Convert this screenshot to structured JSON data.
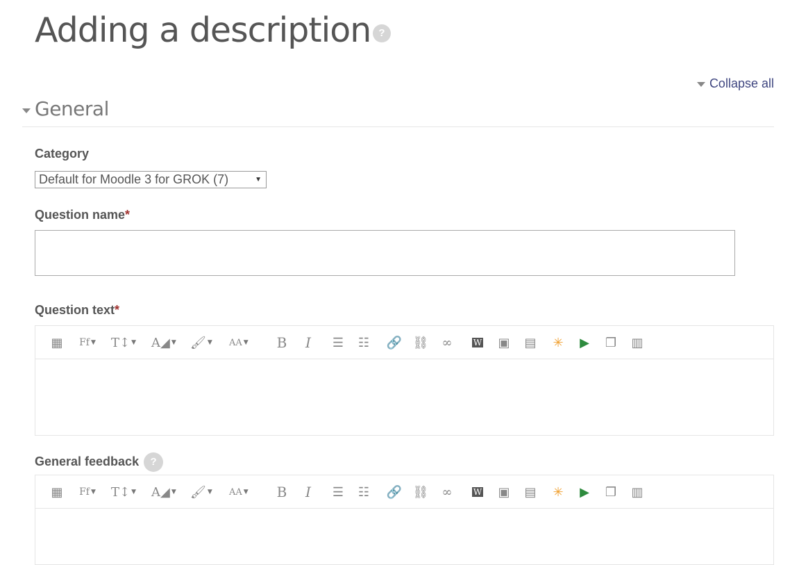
{
  "page": {
    "title": "Adding a description",
    "help_glyph": "?",
    "collapse_all": "Collapse all"
  },
  "section": {
    "title": "General"
  },
  "fields": {
    "category_label": "Category",
    "category_value": "Default for Moodle 3 for GROK (7)",
    "question_name_label": "Question name",
    "question_text_label": "Question text",
    "general_feedback_label": "General feedback",
    "required_mark": "*",
    "question_name_value": ""
  },
  "toolbar": {
    "buttons": [
      {
        "name": "show-more-buttons-icon",
        "glyph": "▦"
      },
      {
        "name": "font-family-icon",
        "glyph": "Ff"
      },
      {
        "name": "font-size-icon",
        "glyph": "T↕"
      },
      {
        "name": "font-color-icon",
        "glyph": "A◢"
      },
      {
        "name": "background-color-icon",
        "glyph": "🖌"
      },
      {
        "name": "text-style-icon",
        "glyph": "AA"
      },
      {
        "name": "bold-icon",
        "glyph": "B"
      },
      {
        "name": "italic-icon",
        "glyph": "I"
      },
      {
        "name": "unordered-list-icon",
        "glyph": "☰"
      },
      {
        "name": "ordered-list-icon",
        "glyph": "☷"
      },
      {
        "name": "link-icon",
        "glyph": "🔗"
      },
      {
        "name": "unlink-icon",
        "glyph": "⛓"
      },
      {
        "name": "auto-link-icon",
        "glyph": "∞"
      },
      {
        "name": "word-icon",
        "glyph": "W"
      },
      {
        "name": "image-icon",
        "glyph": "▣"
      },
      {
        "name": "media-icon",
        "glyph": "▤"
      },
      {
        "name": "multimedia-icon",
        "glyph": "✳"
      },
      {
        "name": "recordrtc-icon",
        "glyph": "▶"
      },
      {
        "name": "copy-icon",
        "glyph": "❐"
      },
      {
        "name": "paste-icon",
        "glyph": "▥"
      }
    ]
  },
  "colors": {
    "accent": "#3f4680",
    "required": "#a0312e",
    "border": "#e5e5e5"
  }
}
